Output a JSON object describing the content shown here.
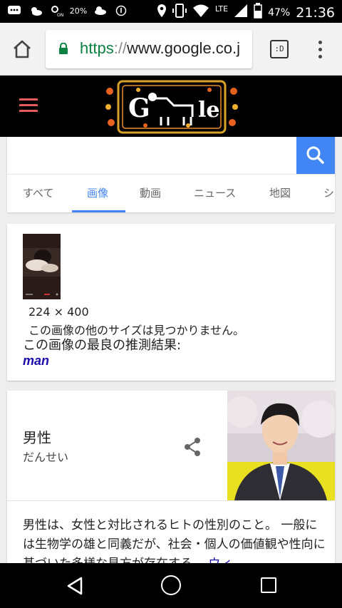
{
  "status_bar": {
    "time": "21:36",
    "battery": "47%",
    "network": "LTE",
    "data_speed": "20%",
    "icons_left": [
      "message-icon",
      "weather-icon",
      "nfc-icon",
      "data-icon",
      "weather-icon",
      "info-icon"
    ],
    "icons_right": [
      "location-icon",
      "vibrate-icon",
      "wifi-icon",
      "signal-icon",
      "battery-icon"
    ]
  },
  "browser": {
    "url_scheme": "https",
    "url_sep": "://",
    "url_host": "www.google.co.j",
    "tabs_label": ":D"
  },
  "search": {
    "value": "",
    "placeholder": ""
  },
  "tabs": [
    {
      "label": "すべて",
      "active": false
    },
    {
      "label": "画像",
      "active": true
    },
    {
      "label": "動画",
      "active": false
    },
    {
      "label": "ニュース",
      "active": false
    },
    {
      "label": "地図",
      "active": false
    },
    {
      "label": "シ",
      "active": false
    }
  ],
  "image_card": {
    "dimensions": "224 × 400",
    "no_other_sizes": "この画像の他のサイズは見つかりません。",
    "best_guess_label": "この画像の最良の推測結果:",
    "best_guess_link": "man"
  },
  "knowledge_panel": {
    "title": "男性",
    "reading": "だんせい",
    "description": "男性は、女性と対比されるヒトの性別のこと。 一般には生物学の雄と同義だが、社会・個人の価値観や性向に基づいた多様な見方が存在する。",
    "more_link": "ウィ"
  },
  "colors": {
    "accent": "#4285f4",
    "link": "#1a0dab",
    "secure": "#0b8043",
    "menu": "#e55a5a"
  }
}
